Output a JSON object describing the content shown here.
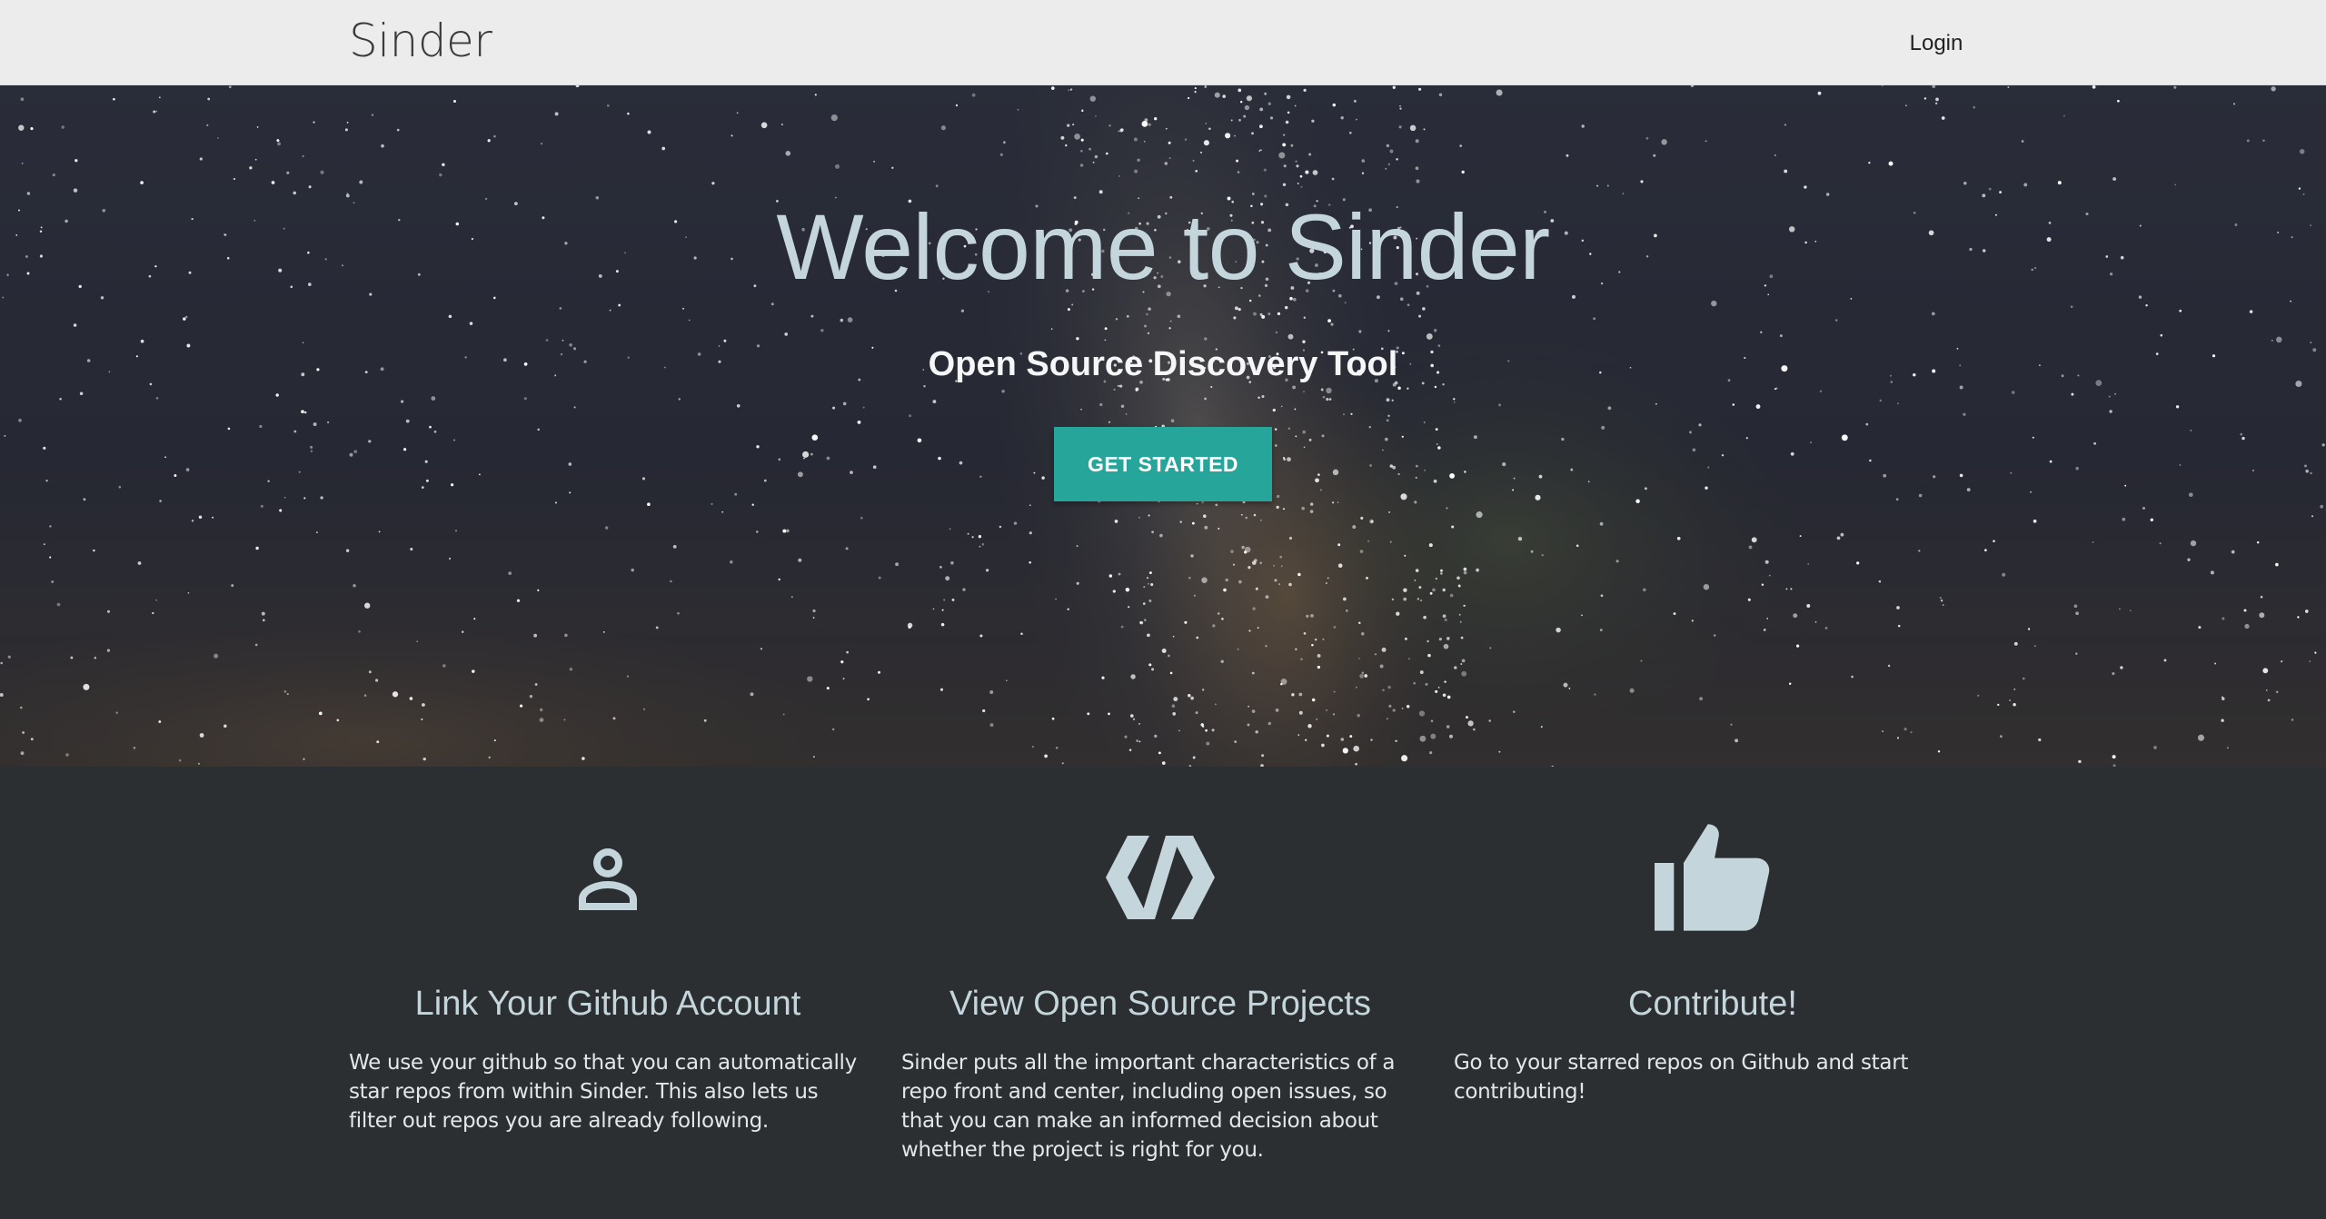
{
  "navbar": {
    "brand": "Sinder",
    "login_label": "Login"
  },
  "hero": {
    "title": "Welcome to Sinder",
    "subtitle": "Open Source Discovery Tool",
    "cta_label": "GET STARTED"
  },
  "features": [
    {
      "icon": "person-icon",
      "title": "Link Your Github Account",
      "text": "We use your github so that you can automatically star repos from within Sinder. This also lets us filter out repos you are already following."
    },
    {
      "icon": "code-icon",
      "title": "View Open Source Projects",
      "text": "Sinder puts all the important characteristics of a repo front and center, including open issues, so that you can make an informed decision about whether the project is right for you."
    },
    {
      "icon": "thumb-up-icon",
      "title": "Contribute!",
      "text": "Go to your starred repos on Github and start contributing!"
    }
  ],
  "colors": {
    "accent": "#26a69a",
    "navbar_bg": "#ececec",
    "features_bg": "#2b2f32",
    "icon_color": "#c4d5dc"
  }
}
